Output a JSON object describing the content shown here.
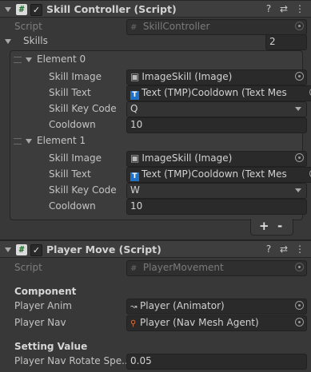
{
  "skill_controller": {
    "title": "Skill Controller (Script)",
    "script_label": "Script",
    "script_value": "SkillController",
    "skills_label": "Skills",
    "skills_count": "2",
    "elements": [
      {
        "header": "Element 0",
        "skill_image_label": "Skill Image",
        "skill_image_value": "ImageSkill (Image)",
        "skill_text_label": "Skill Text",
        "skill_text_value": "Text (TMP)Cooldown (Text Mes",
        "skill_key_label": "Skill Key Code",
        "skill_key_value": "Q",
        "cooldown_label": "Cooldown",
        "cooldown_value": "10"
      },
      {
        "header": "Element 1",
        "skill_image_label": "Skill Image",
        "skill_image_value": "ImageSkill (Image)",
        "skill_text_label": "Skill Text",
        "skill_text_value": "Text (TMP)Cooldown (Text Mes",
        "skill_key_label": "Skill Key Code",
        "skill_key_value": "W",
        "cooldown_label": "Cooldown",
        "cooldown_value": "10"
      }
    ],
    "add_label": "+",
    "remove_label": "-"
  },
  "player_move": {
    "title": "Player Move (Script)",
    "script_label": "Script",
    "script_value": "PlayerMovement",
    "component_header": "Component",
    "player_anim_label": "Player Anim",
    "player_anim_value": "Player (Animator)",
    "player_nav_label": "Player Nav",
    "player_nav_value": "Player (Nav Mesh Agent)",
    "setting_header": "Setting Value",
    "rotate_label": "Player Nav Rotate Spe...",
    "rotate_value": "0.05"
  },
  "icons": {
    "script": "#",
    "check": "✓",
    "help": "?",
    "settings": "⇄",
    "more": "⋮",
    "image": "▣",
    "tmp": "T",
    "animator": "↝",
    "navmesh": "⚲"
  }
}
